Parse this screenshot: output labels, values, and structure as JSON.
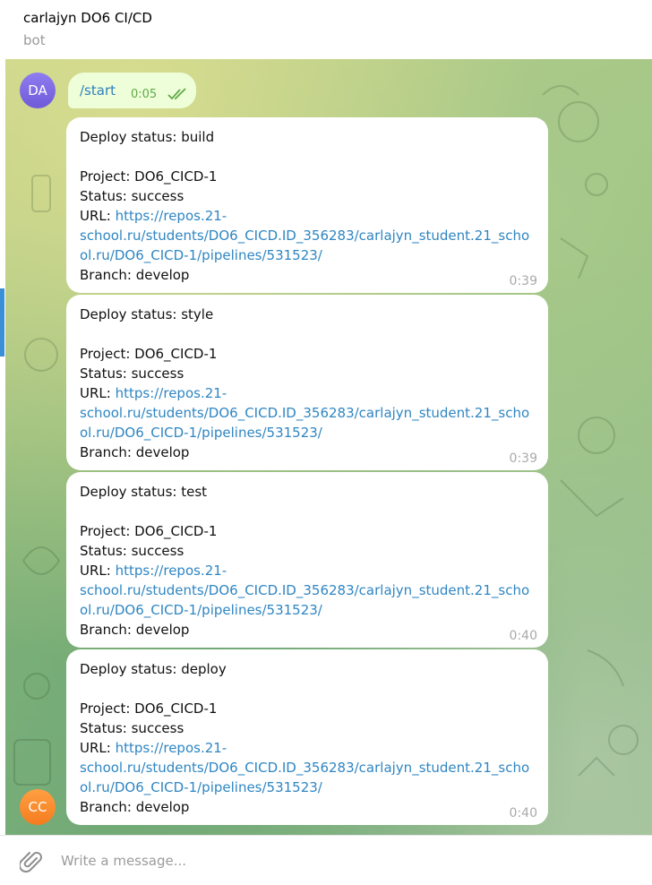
{
  "header": {
    "title": "carlajyn DO6 CI/CD",
    "subtitle": "bot"
  },
  "avatars": {
    "user": "DA",
    "bot": "CC"
  },
  "outgoing": {
    "text": "/start",
    "time": "0:05"
  },
  "messages": [
    {
      "status": "Deploy status: build",
      "project": "Project: DO6_CICD-1",
      "state": "Status: success",
      "url_prefix": "URL: ",
      "url_line1": "https://repos.21-",
      "url_line2": "school.ru/students/DO6_CICD.ID_356283/carlajyn_student.21_scho",
      "url_line3": "ol.ru/DO6_CICD-1/pipelines/531523/",
      "branch": "Branch: develop",
      "time": "0:39"
    },
    {
      "status": "Deploy status: style",
      "project": "Project: DO6_CICD-1",
      "state": "Status: success",
      "url_prefix": "URL: ",
      "url_line1": "https://repos.21-",
      "url_line2": "school.ru/students/DO6_CICD.ID_356283/carlajyn_student.21_scho",
      "url_line3": "ol.ru/DO6_CICD-1/pipelines/531523/",
      "branch": "Branch: develop",
      "time": "0:39"
    },
    {
      "status": "Deploy status: test",
      "project": "Project: DO6_CICD-1",
      "state": "Status: success",
      "url_prefix": "URL: ",
      "url_line1": "https://repos.21-",
      "url_line2": "school.ru/students/DO6_CICD.ID_356283/carlajyn_student.21_scho",
      "url_line3": "ol.ru/DO6_CICD-1/pipelines/531523/",
      "branch": "Branch: develop",
      "time": "0:40"
    },
    {
      "status": "Deploy status: deploy",
      "project": "Project: DO6_CICD-1",
      "state": "Status: success",
      "url_prefix": "URL: ",
      "url_line1": "https://repos.21-",
      "url_line2": "school.ru/students/DO6_CICD.ID_356283/carlajyn_student.21_scho",
      "url_line3": "ol.ru/DO6_CICD-1/pipelines/531523/",
      "branch": "Branch: develop",
      "time": "0:40"
    }
  ],
  "composer": {
    "placeholder": "Write a message..."
  },
  "icons": {
    "attach": "paperclip-icon",
    "read": "double-check-icon"
  },
  "colors": {
    "link": "#2f86c2",
    "outgoing_bubble": "#eefed8",
    "read_check": "#5fa94a"
  }
}
